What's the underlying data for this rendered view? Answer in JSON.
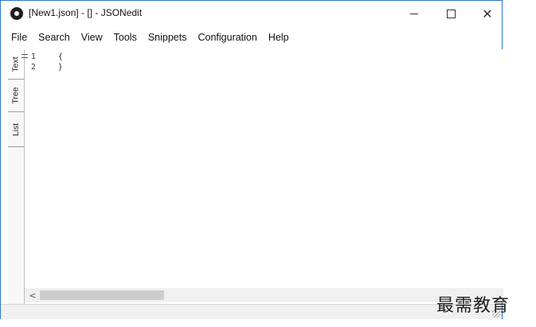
{
  "window": {
    "title": "[New1.json] - [] - JSONedit",
    "icon": "app-logo-icon",
    "controls": [
      "minimize-icon",
      "maximize-icon",
      "close-icon"
    ]
  },
  "menu": [
    "File",
    "Search",
    "View",
    "Tools",
    "Snippets",
    "Configuration",
    "Help"
  ],
  "side_tabs": [
    "Text",
    "Tree",
    "List"
  ],
  "editor": {
    "line_numbers": [
      "1",
      "2"
    ],
    "lines": [
      "{",
      "}"
    ]
  },
  "scrollbar": {
    "left_arrow": "<"
  },
  "watermark": "最需教育"
}
